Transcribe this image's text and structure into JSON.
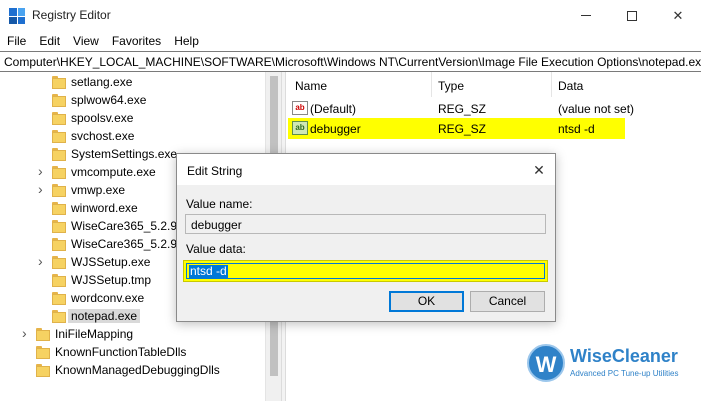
{
  "window": {
    "title": "Registry Editor"
  },
  "menu": [
    "File",
    "Edit",
    "View",
    "Favorites",
    "Help"
  ],
  "address": "Computer\\HKEY_LOCAL_MACHINE\\SOFTWARE\\Microsoft\\Windows NT\\CurrentVersion\\Image File Execution Options\\notepad.exe",
  "tree": {
    "items": [
      {
        "label": "setlang.exe",
        "expandable": false,
        "depth": 2
      },
      {
        "label": "splwow64.exe",
        "expandable": false,
        "depth": 2
      },
      {
        "label": "spoolsv.exe",
        "expandable": false,
        "depth": 2
      },
      {
        "label": "svchost.exe",
        "expandable": false,
        "depth": 2
      },
      {
        "label": "SystemSettings.exe",
        "expandable": false,
        "depth": 2
      },
      {
        "label": "vmcompute.exe",
        "expandable": true,
        "depth": 2
      },
      {
        "label": "vmwp.exe",
        "expandable": true,
        "depth": 2
      },
      {
        "label": "winword.exe",
        "expandable": false,
        "depth": 2
      },
      {
        "label": "WiseCare365_5.2.9.5",
        "expandable": false,
        "depth": 2
      },
      {
        "label": "WiseCare365_5.2.9.5",
        "expandable": false,
        "depth": 2
      },
      {
        "label": "WJSSetup.exe",
        "expandable": true,
        "depth": 2
      },
      {
        "label": "WJSSetup.tmp",
        "expandable": false,
        "depth": 2
      },
      {
        "label": "wordconv.exe",
        "expandable": false,
        "depth": 2
      },
      {
        "label": "notepad.exe",
        "expandable": false,
        "depth": 2,
        "selected": true
      },
      {
        "label": "IniFileMapping",
        "expandable": true,
        "depth": 1
      },
      {
        "label": "KnownFunctionTableDlls",
        "expandable": false,
        "depth": 1
      },
      {
        "label": "KnownManagedDebuggingDlls",
        "expandable": false,
        "depth": 1
      }
    ]
  },
  "list": {
    "columns": [
      "Name",
      "Type",
      "Data"
    ],
    "rows": [
      {
        "icon": "ab",
        "name": "(Default)",
        "type": "REG_SZ",
        "data": "(value not set)",
        "highlight": false
      },
      {
        "icon": "ab",
        "name": "debugger",
        "type": "REG_SZ",
        "data": "ntsd -d",
        "highlight": true
      }
    ]
  },
  "dialog": {
    "title": "Edit String",
    "close_glyph": "✕",
    "value_name_label": "Value name:",
    "value_name": "debugger",
    "value_data_label": "Value data:",
    "value_data": "ntsd -d",
    "ok_label": "OK",
    "cancel_label": "Cancel"
  },
  "watermark": {
    "logo_letter": "W",
    "name": "WiseCleaner",
    "tagline": "Advanced PC Tune-up Utilities"
  },
  "colors": {
    "highlight": "#ffff00",
    "accent": "#0078d7",
    "brand": "#2f82c8"
  }
}
